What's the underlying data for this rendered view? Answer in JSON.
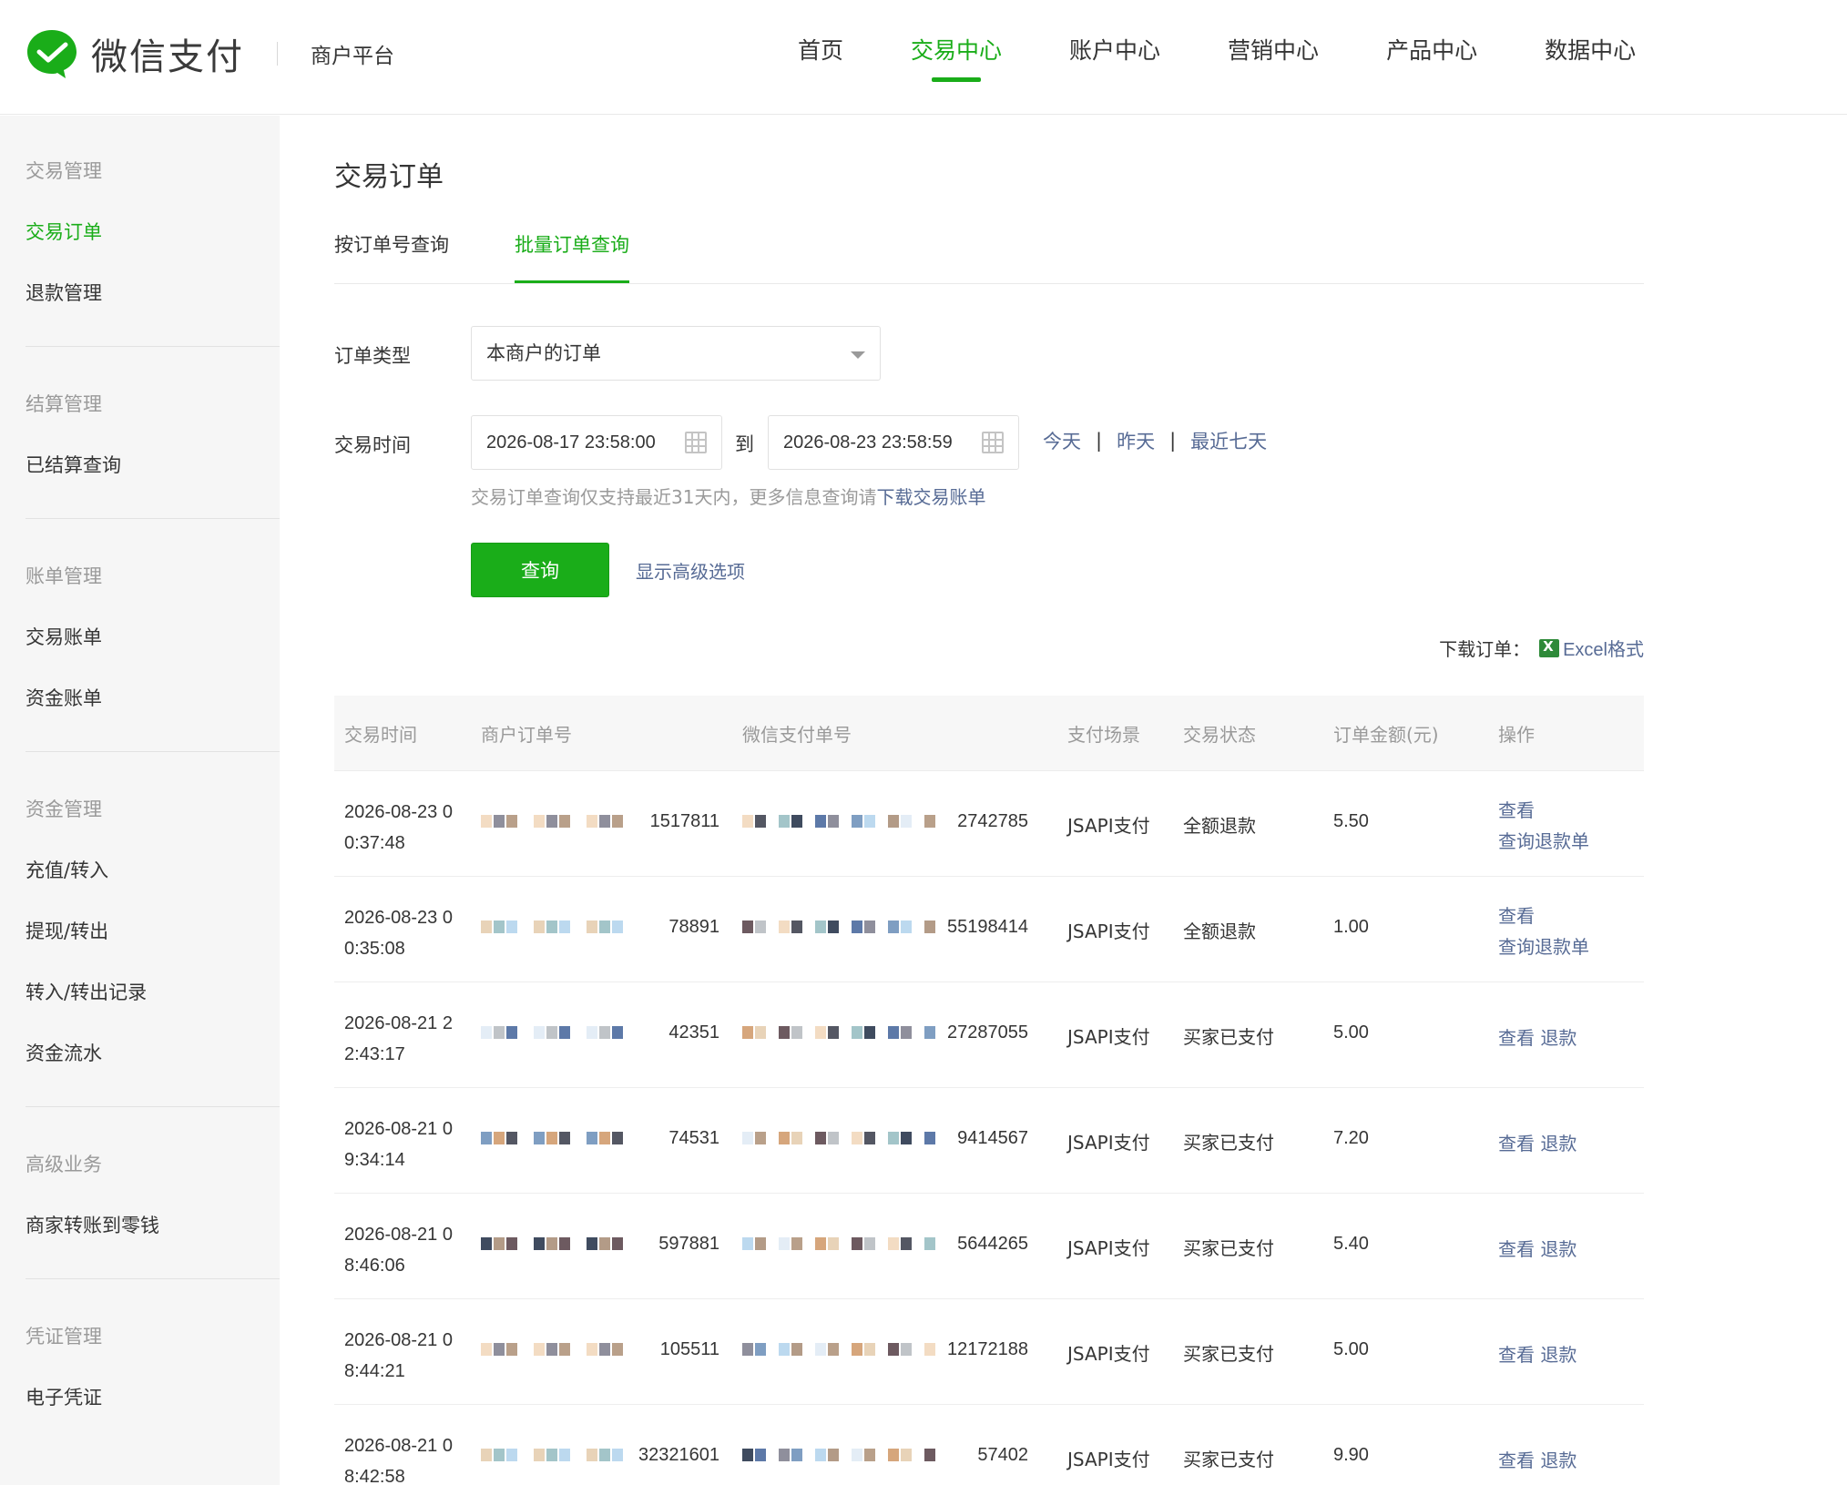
{
  "header": {
    "brand": "微信支付",
    "subtitle": "商户平台",
    "nav": [
      {
        "label": "首页",
        "active": false
      },
      {
        "label": "交易中心",
        "active": true
      },
      {
        "label": "账户中心",
        "active": false
      },
      {
        "label": "营销中心",
        "active": false
      },
      {
        "label": "产品中心",
        "active": false
      },
      {
        "label": "数据中心",
        "active": false
      }
    ]
  },
  "sidebar": {
    "groups": [
      {
        "title": "交易管理",
        "items": [
          "交易订单",
          "退款管理"
        ]
      },
      {
        "title": "结算管理",
        "items": [
          "已结算查询"
        ]
      },
      {
        "title": "账单管理",
        "items": [
          "交易账单",
          "资金账单"
        ]
      },
      {
        "title": "资金管理",
        "items": [
          "充值/转入",
          "提现/转出",
          "转入/转出记录",
          "资金流水"
        ]
      },
      {
        "title": "高级业务",
        "items": [
          "商家转账到零钱"
        ]
      },
      {
        "title": "凭证管理",
        "items": [
          "电子凭证"
        ]
      }
    ],
    "active_item": "交易订单"
  },
  "main": {
    "title": "交易订单",
    "tabs": [
      {
        "label": "按订单号查询",
        "active": false
      },
      {
        "label": "批量订单查询",
        "active": true
      }
    ],
    "form": {
      "order_type_label": "订单类型",
      "order_type_value": "本商户的订单",
      "time_label": "交易时间",
      "start_time": "2026-08-17 23:58:00",
      "to_label": "到",
      "end_time": "2026-08-23 23:58:59",
      "quick": [
        "今天",
        "昨天",
        "最近七天"
      ],
      "hint_prefix": "交易订单查询仅支持最近31天内，更多信息查询请",
      "hint_link": "下载交易账单",
      "query_button": "查询",
      "advanced_link": "显示高级选项"
    },
    "download": {
      "label": "下载订单：",
      "excel_link": "Excel格式"
    },
    "table": {
      "headers": [
        "交易时间",
        "商户订单号",
        "微信支付单号",
        "支付场景",
        "交易状态",
        "订单金额(元)",
        "操作"
      ],
      "rows": [
        {
          "time": "2026-08-23 00:37:48",
          "order_tail": "1517811",
          "wx_tail": "2742785",
          "scene": "JSAPI支付",
          "status": "全额退款",
          "amount": "5.50",
          "ops": [
            "查看",
            "查询退款单"
          ]
        },
        {
          "time": "2026-08-23 00:35:08",
          "order_tail": "78891",
          "wx_tail": "55198414",
          "scene": "JSAPI支付",
          "status": "全额退款",
          "amount": "1.00",
          "ops": [
            "查看",
            "查询退款单"
          ]
        },
        {
          "time": "2026-08-21 22:43:17",
          "order_tail": "42351",
          "wx_tail": "27287055",
          "scene": "JSAPI支付",
          "status": "买家已支付",
          "amount": "5.00",
          "ops": [
            "查看",
            "退款"
          ]
        },
        {
          "time": "2026-08-21 09:34:14",
          "order_tail": "74531",
          "wx_tail": "9414567",
          "scene": "JSAPI支付",
          "status": "买家已支付",
          "amount": "7.20",
          "ops": [
            "查看",
            "退款"
          ]
        },
        {
          "time": "2026-08-21 08:46:06",
          "order_tail": "597881",
          "wx_tail": "5644265",
          "scene": "JSAPI支付",
          "status": "买家已支付",
          "amount": "5.40",
          "ops": [
            "查看",
            "退款"
          ]
        },
        {
          "time": "2026-08-21 08:44:21",
          "order_tail": "105511",
          "wx_tail": "12172188",
          "scene": "JSAPI支付",
          "status": "买家已支付",
          "amount": "5.00",
          "ops": [
            "查看",
            "退款"
          ]
        },
        {
          "time": "2026-08-21 08:42:58",
          "order_tail": "32321601",
          "wx_tail": "57402",
          "scene": "JSAPI支付",
          "status": "买家已支付",
          "amount": "9.90",
          "ops": [
            "查看",
            "退款"
          ]
        }
      ]
    }
  },
  "colors": {
    "brand_green": "#1aad19",
    "link_blue": "#576b95",
    "muted_gray": "#9a9a9a",
    "text": "#353535"
  }
}
